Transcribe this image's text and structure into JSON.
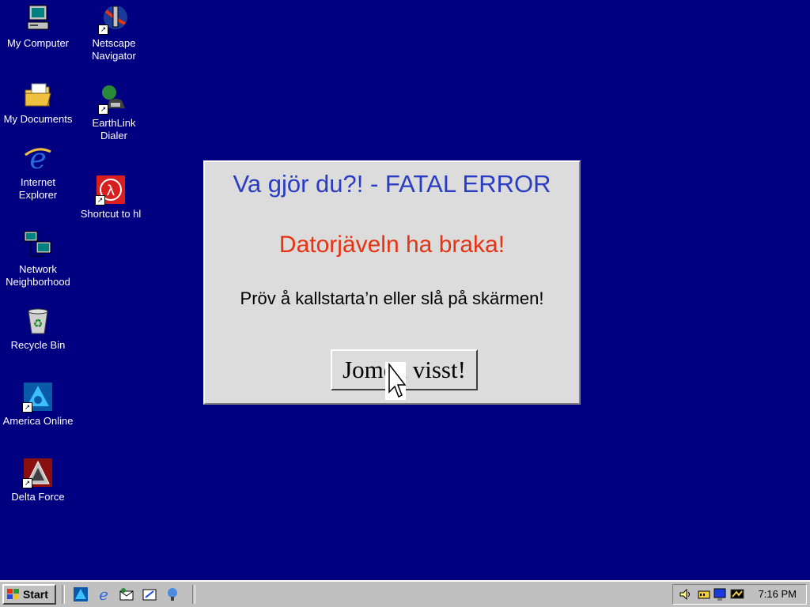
{
  "desktop": {
    "icons": [
      {
        "label": "My Computer"
      },
      {
        "label": "Netscape Navigator"
      },
      {
        "label": "My Documents"
      },
      {
        "label": "EarthLink Dialer"
      },
      {
        "label": "Internet Explorer"
      },
      {
        "label": "Shortcut to hl"
      },
      {
        "label": "Network Neighborhood"
      },
      {
        "label": "Recycle Bin"
      },
      {
        "label": "America Online"
      },
      {
        "label": "Delta Force"
      }
    ]
  },
  "dialog": {
    "title": "Va gjör du?! - FATAL ERROR",
    "subtitle": "Datorjäveln ha braka!",
    "message": "Pröv å kallstarta’n eller slå på skärmen!",
    "button_label": "Jomen visst!"
  },
  "taskbar": {
    "start_label": "Start",
    "clock": "7:16 PM"
  },
  "colors": {
    "desktop": "#000080",
    "dialog_title": "#2b3cc4",
    "dialog_subtitle": "#e63312",
    "taskbar": "#c0c0c0"
  }
}
